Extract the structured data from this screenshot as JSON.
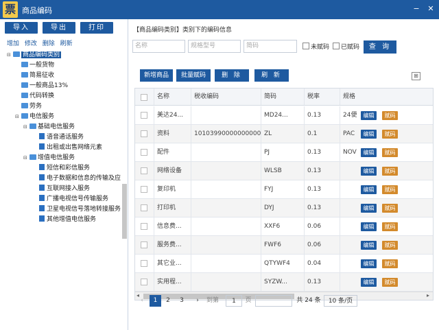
{
  "window": {
    "title": "商品编码",
    "logo": "票",
    "min_glyph": "−",
    "close_glyph": "✕"
  },
  "toolbar": {
    "import": "导入",
    "export": "导出",
    "print": "打印"
  },
  "tree_actions": [
    "增加",
    "修改",
    "删除",
    "刷新"
  ],
  "tree": [
    {
      "label": "商品编码类别",
      "toggle": "⊟",
      "selected": true
    },
    {
      "label": "一般货物"
    },
    {
      "label": "简易征收"
    },
    {
      "label": "一般商品13%"
    },
    {
      "label": "代码转换"
    },
    {
      "label": "劳务"
    },
    {
      "label": "电信服务",
      "toggle": "⊟"
    },
    {
      "label": "基础电信服务",
      "toggle": "⊟"
    },
    {
      "label": "语音通话服务"
    },
    {
      "label": "出租或出售网络元素"
    },
    {
      "label": "增值电信服务",
      "toggle": "⊟"
    },
    {
      "label": "短信和彩信服务"
    },
    {
      "label": "电子数据和信息的传输及应"
    },
    {
      "label": "互联网接入服务"
    },
    {
      "label": "广播电视信号传输服务"
    },
    {
      "label": "卫星电视信号落地转接服务"
    },
    {
      "label": "其他增值电信服务"
    }
  ],
  "main": {
    "caption": "【商品编码类别】类别下的编码信息",
    "filters": {
      "name_placeholder": "名称",
      "spec_placeholder": "规格型号",
      "short_placeholder": "简码"
    },
    "checks": {
      "unassigned": "未赋码",
      "assigned": "已赋码"
    },
    "query_button": "查 询",
    "actions": {
      "new": "新增商品",
      "batch": "批量赋码",
      "delete": "删 除",
      "refresh": "刷 新"
    },
    "grid_icon": "⊞",
    "columns": {
      "name": "名称",
      "tax_code": "税收编码",
      "short": "简码",
      "rate": "税率",
      "spec": "规格"
    },
    "row_buttons": {
      "edit": "编辑",
      "assign": "赋码"
    },
    "rows": [
      {
        "name": "美达24...",
        "tax_code": "",
        "short": "MD24...",
        "rate": "0.13",
        "spec": "24便"
      },
      {
        "name": "资料",
        "tax_code": "1010399000000000000",
        "short": "ZL",
        "rate": "0.1",
        "spec": "PAC"
      },
      {
        "name": "配件",
        "tax_code": "",
        "short": "PJ",
        "rate": "0.13",
        "spec": "NOV"
      },
      {
        "name": "网络设备",
        "tax_code": "",
        "short": "WLSB",
        "rate": "0.13",
        "spec": ""
      },
      {
        "name": "复印机",
        "tax_code": "",
        "short": "FYJ",
        "rate": "0.13",
        "spec": ""
      },
      {
        "name": "打印机",
        "tax_code": "",
        "short": "DYJ",
        "rate": "0.13",
        "spec": ""
      },
      {
        "name": "信息费...",
        "tax_code": "",
        "short": "XXF6",
        "rate": "0.06",
        "spec": ""
      },
      {
        "name": "服务费...",
        "tax_code": "",
        "short": "FWF6",
        "rate": "0.06",
        "spec": ""
      },
      {
        "name": "其它业...",
        "tax_code": "",
        "short": "QTYWF4",
        "rate": "0.04",
        "spec": ""
      },
      {
        "name": "实用程...",
        "tax_code": "",
        "short": "SYZW...",
        "rate": "0.13",
        "spec": ""
      }
    ],
    "scroll_left": "◂",
    "scroll_right": "▸",
    "pager": {
      "prev": "‹",
      "pages": [
        "1",
        "2",
        "3"
      ],
      "next": "›",
      "goto": "到第",
      "page_value": "1",
      "page_unit": "页",
      "confirm": "",
      "total": "共 24 条",
      "page_size": "10 条/页"
    }
  }
}
